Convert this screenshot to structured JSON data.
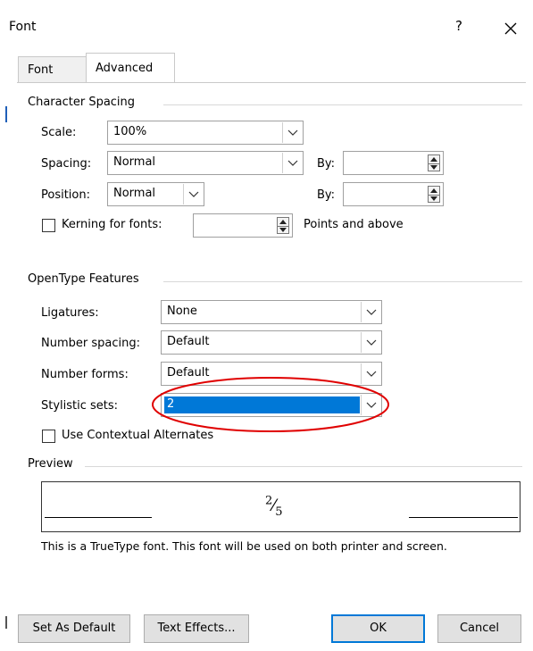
{
  "window": {
    "title": "Font",
    "help": "?"
  },
  "tabs": [
    {
      "label": "Font",
      "active": false
    },
    {
      "label": "Advanced",
      "active": true
    }
  ],
  "character_spacing": {
    "section_title": "Character Spacing",
    "scale": {
      "label": "Scale:",
      "value": "100%"
    },
    "spacing": {
      "label": "Spacing:",
      "value": "Normal",
      "by_label": "By:",
      "by_value": ""
    },
    "position": {
      "label": "Position:",
      "value": "Normal",
      "by_label": "By:",
      "by_value": ""
    },
    "kerning": {
      "label": "Kerning for fonts:",
      "checked": false,
      "value": "",
      "suffix": "Points and above"
    }
  },
  "opentype": {
    "section_title": "OpenType Features",
    "ligatures": {
      "label": "Ligatures:",
      "value": "None"
    },
    "number_spacing": {
      "label": "Number spacing:",
      "value": "Default"
    },
    "number_forms": {
      "label": "Number forms:",
      "value": "Default"
    },
    "stylistic_sets": {
      "label": "Stylistic sets:",
      "value": "2"
    },
    "contextual_alternates": {
      "label": "Use Contextual Alternates",
      "checked": false
    }
  },
  "preview": {
    "section_title": "Preview",
    "sample_numerator": "2",
    "sample_denominator": "5",
    "note": "This is a TrueType font. This font will be used on both printer and screen."
  },
  "buttons": {
    "set_default": "Set As Default",
    "text_effects": "Text Effects...",
    "ok": "OK",
    "cancel": "Cancel"
  },
  "colors": {
    "selection": "#0078d7",
    "highlight_ellipse": "#e00000"
  }
}
